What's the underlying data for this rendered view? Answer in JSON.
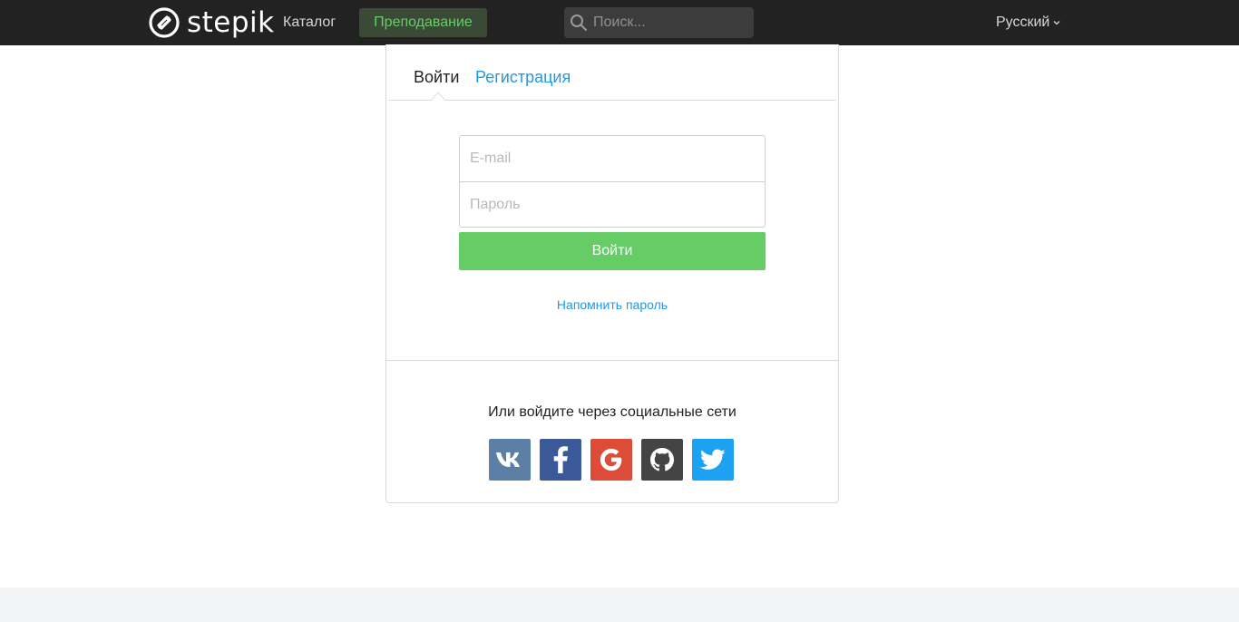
{
  "header": {
    "logo_text": "stepik",
    "catalog_label": "Каталог",
    "teaching_label": "Преподавание",
    "search": {
      "placeholder": "Поиск..."
    },
    "language_label": "Русский"
  },
  "auth": {
    "tabs": [
      {
        "label": "Войти",
        "active": true
      },
      {
        "label": "Регистрация",
        "active": false
      }
    ],
    "email_placeholder": "E-mail",
    "password_placeholder": "Пароль",
    "login_button_label": "Войти",
    "remind_password_label": "Напомнить пароль",
    "social_title": "Или войдите через социальные сети",
    "social_buttons": [
      {
        "icon": "vk-icon",
        "color": "#5c7fa6"
      },
      {
        "icon": "facebook-icon",
        "color": "#3b5998"
      },
      {
        "icon": "google-icon",
        "color": "#dd4b39"
      },
      {
        "icon": "github-icon",
        "color": "#444444"
      },
      {
        "icon": "twitter-icon",
        "color": "#1da1f2"
      }
    ]
  },
  "colors": {
    "header_bg": "#222222",
    "accent_green": "#66cc66",
    "link_blue": "#1e9ae0",
    "footer_bg": "#f2f3f5"
  }
}
